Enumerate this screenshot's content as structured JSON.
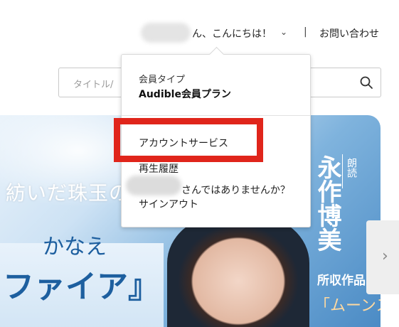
{
  "header": {
    "greeting": "ん、こんにちは！",
    "separator": "|",
    "contact_label": "お問い合わせ"
  },
  "search": {
    "placeholder": "タイトル/"
  },
  "account_menu": {
    "plan_label": "会員タイプ",
    "plan_name": "Audible会員プラン",
    "items": [
      {
        "label": "アカウントサービス"
      },
      {
        "label": "再生履歴"
      },
      {
        "label": "さんではありませんか？"
      },
      {
        "label": "サインアウト"
      }
    ]
  },
  "hero": {
    "title_line1": "紡いだ珠玉の物",
    "title_line2": "かなえ",
    "title_line3": "ファイア』",
    "narrator_label": "朗読",
    "narrator_name": "永作博美",
    "works_label": "所収作品",
    "works_title": "「ムーンストーン"
  },
  "icons": {
    "search": "search-icon",
    "chevron": "chevron-down-icon",
    "next": "chevron-right-icon"
  },
  "colors": {
    "highlight": "#e0251b",
    "hero_blue": "#1d5f9f"
  }
}
